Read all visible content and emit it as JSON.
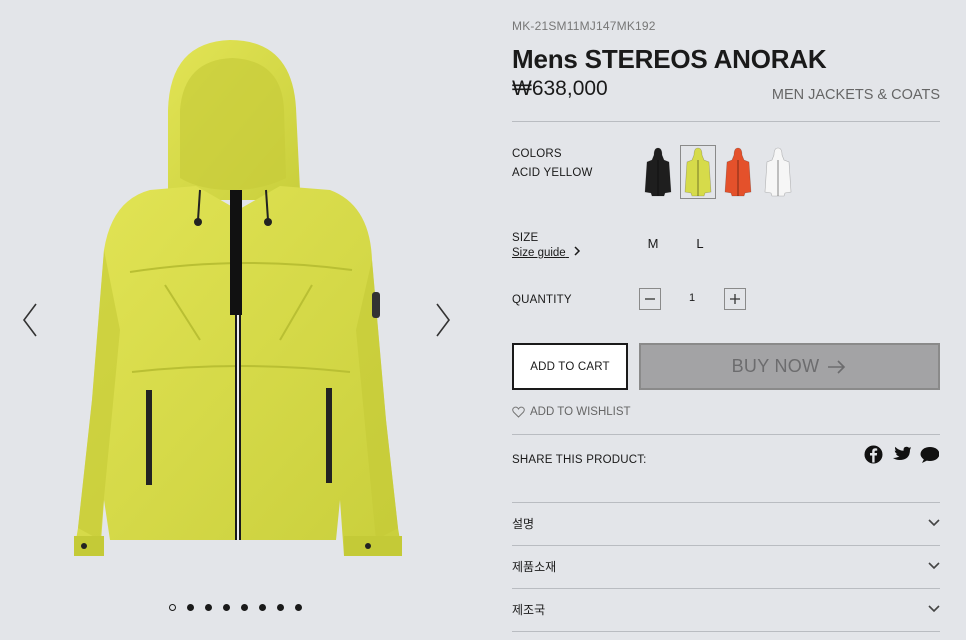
{
  "gallery": {
    "prev_icon": "chevron-left-icon",
    "next_icon": "chevron-right-icon",
    "dot_count": 8,
    "active_dot": 0
  },
  "product": {
    "sku": "MK-21SM11MJ147MK192",
    "title": "Mens STEREOS ANORAK",
    "price": "₩638,000",
    "category": "MEN JACKETS & COATS"
  },
  "colors": {
    "label": "COLORS",
    "selected_name": "ACID YELLOW",
    "swatches": [
      {
        "name": "black",
        "hex": "#1e1e1e",
        "selected": false
      },
      {
        "name": "acid-yellow",
        "hex": "#d6db4a",
        "selected": true
      },
      {
        "name": "orange",
        "hex": "#e4512b",
        "selected": false
      },
      {
        "name": "white",
        "hex": "#f6f6f6",
        "selected": false
      }
    ]
  },
  "size": {
    "label": "SIZE",
    "guide_label": "Size guide",
    "options": [
      "M",
      "L"
    ]
  },
  "quantity": {
    "label": "QUANTITY",
    "value": "1"
  },
  "actions": {
    "add_to_cart": "ADD TO CART",
    "buy_now": "BUY NOW",
    "wishlist": "ADD TO WISHLIST"
  },
  "share": {
    "label": "SHARE THIS PRODUCT:",
    "icons": [
      "facebook-icon",
      "twitter-icon",
      "chat-icon"
    ]
  },
  "accordion": [
    {
      "label": "설명"
    },
    {
      "label": "제품소재"
    },
    {
      "label": "제조국"
    }
  ],
  "colors_theme": {
    "background": "#e3e5e9",
    "product_yellow": "#d8dc4c",
    "buy_button": "#a3a3a5"
  }
}
